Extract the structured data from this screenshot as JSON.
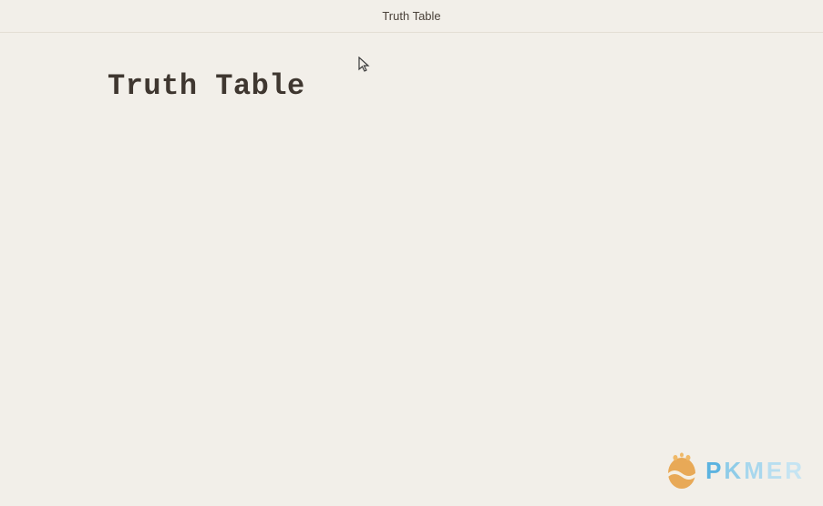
{
  "titlebar": {
    "title": "Truth Table"
  },
  "page": {
    "heading": "Truth Table"
  },
  "watermark": {
    "brand": "PKMER",
    "letters": [
      "P",
      "K",
      "M",
      "E",
      "R"
    ]
  }
}
